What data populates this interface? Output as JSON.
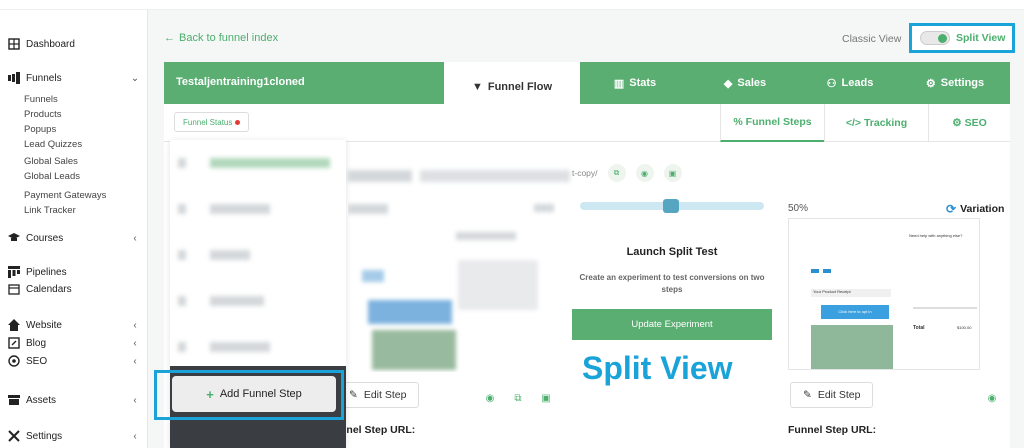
{
  "sidebar": {
    "dashboard": "Dashboard",
    "funnels": "Funnels",
    "funnels_sub": [
      "Funnels",
      "Products",
      "Popups",
      "Lead Quizzes",
      "Global Sales",
      "Global Leads",
      "Payment Gateways",
      "Link Tracker"
    ],
    "courses": "Courses",
    "pipelines": "Pipelines",
    "calendars": "Calendars",
    "website": "Website",
    "blog": "Blog",
    "seo": "SEO",
    "assets": "Assets",
    "settings": "Settings"
  },
  "main": {
    "back_link": "Back to funnel index",
    "classic_view": "Classic View",
    "split_view_toggle": "Split View",
    "funnel_name": "Testaljentraining1cloned",
    "tabs": [
      "Funnel Flow",
      "Stats",
      "Sales",
      "Leads",
      "Settings"
    ],
    "funnel_status": "Funnel Status",
    "subtabs": [
      "% Funnel Steps",
      "Tracking",
      "SEO"
    ],
    "url_suffix": "t-copy/",
    "launch_split_test": "Launch Split Test",
    "split_desc": "Create an experiment to test conversions on two steps",
    "update_experiment": "Update Experiment",
    "split_view_caption": "Split View",
    "split_percent": "50%",
    "variation": "Variation",
    "edit_step": "Edit Step",
    "funnel_step_url": "Funnel Step URL:",
    "funnel_step_url_partial": "nnel Step URL:",
    "add_funnel_step": "Add Funnel Step",
    "thumb_help": "Need help with anything else?",
    "thumb_product": "Your Product Receipt",
    "thumb_cta": "Click here to opt in",
    "thumb_total": "Total",
    "thumb_price": "$100.00"
  },
  "colors": {
    "brand_green": "#5aae72",
    "highlight_blue": "#1aa3d9"
  }
}
